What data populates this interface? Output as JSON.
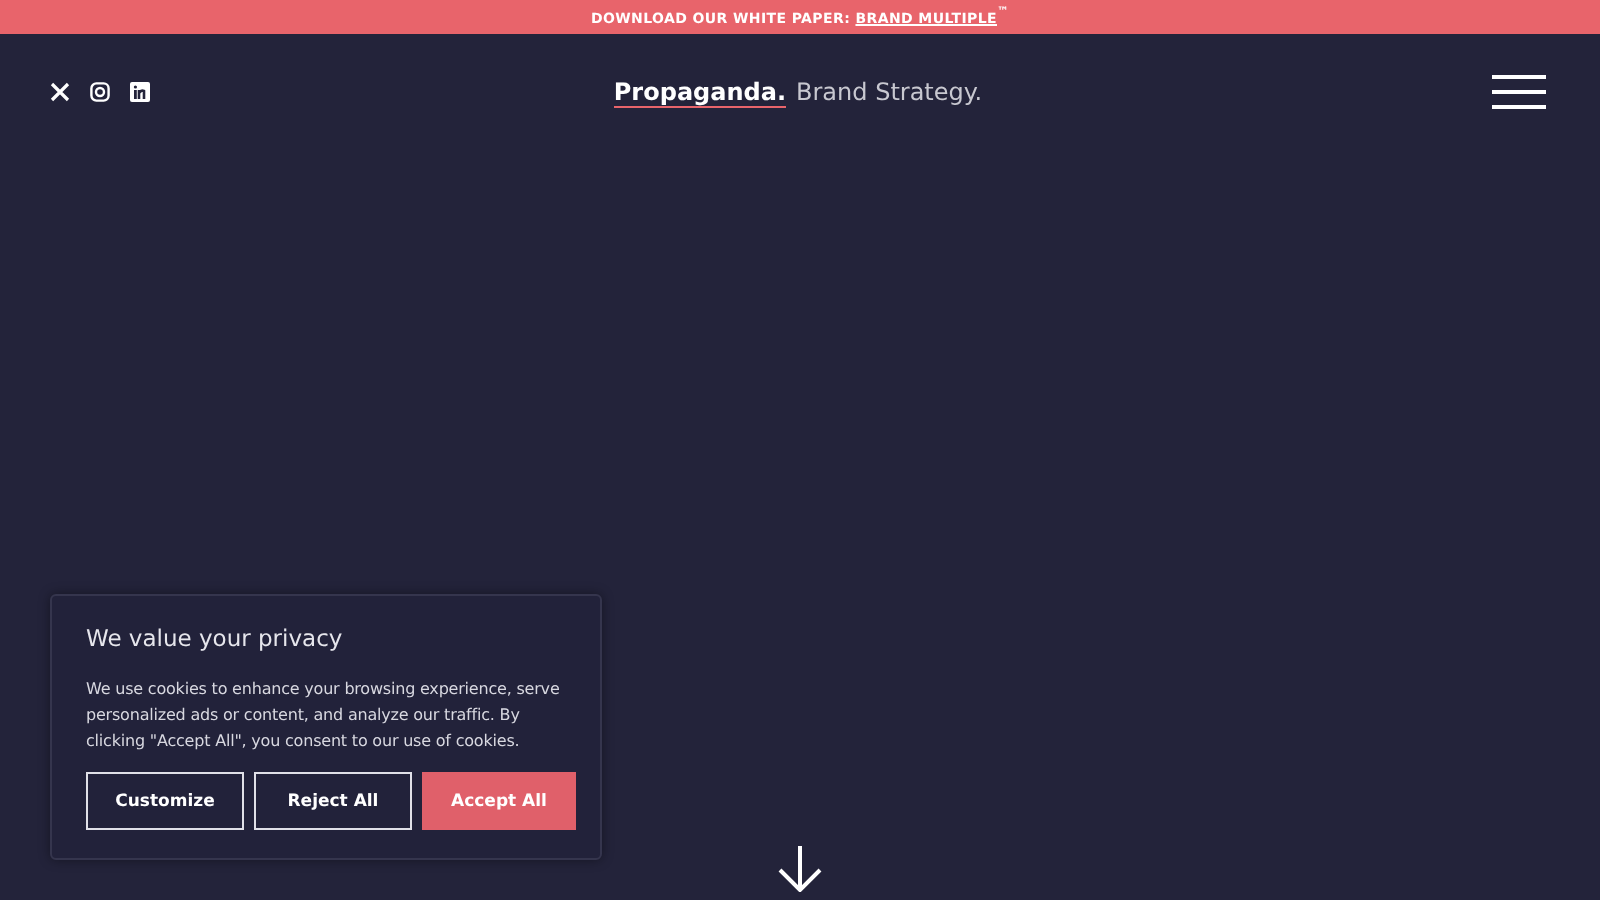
{
  "banner": {
    "text": "DOWNLOAD OUR WHITE PAPER:",
    "link": "BRAND MULTIPLE",
    "suffix": "$^{™}$"
  },
  "header": {
    "social": [
      {
        "kind": "x"
      },
      {
        "kind": "instagram"
      },
      {
        "kind": "linkedin"
      }
    ],
    "logo": "Propaganda.",
    "tagline": "Brand Strategy."
  },
  "cookie_notice": {
    "title": "We value your privacy",
    "body": "We use cookies to enhance your browsing experience, serve personalized ads or content, and analyze our traffic. By clicking \"Accept All\", you consent to our use of cookies.",
    "buttons": [
      {
        "label": "Customize",
        "kind": "outline"
      },
      {
        "label": "Reject All",
        "kind": "outline"
      },
      {
        "label": "Accept All",
        "kind": "primary"
      }
    ]
  }
}
